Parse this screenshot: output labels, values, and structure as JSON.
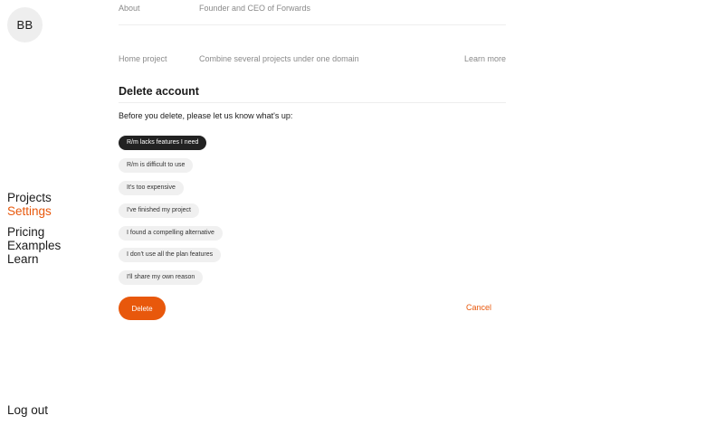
{
  "avatar": {
    "initials": "BB"
  },
  "nav": {
    "group1": [
      "Projects",
      "Settings"
    ],
    "group2": [
      "Pricing",
      "Examples",
      "Learn"
    ],
    "active": "Settings"
  },
  "logout_label": "Log out",
  "info": {
    "rows": [
      {
        "key": "About",
        "value": "Founder and CEO of Forwards",
        "link": ""
      },
      {
        "key": "Home project",
        "value": "Combine several projects under one domain",
        "link": "Learn more"
      }
    ]
  },
  "delete_section": {
    "title": "Delete account",
    "prompt": "Before you delete, please let us know what's up:",
    "reasons": [
      {
        "label": "R/m lacks features I need",
        "selected": true
      },
      {
        "label": "R/m is difficult to use",
        "selected": false
      },
      {
        "label": "It's too expensive",
        "selected": false
      },
      {
        "label": "I've finished my project",
        "selected": false
      },
      {
        "label": "I found a compelling alternative",
        "selected": false
      },
      {
        "label": "I don't use all the plan features",
        "selected": false
      },
      {
        "label": "I'll share my own reason",
        "selected": false
      }
    ],
    "delete_label": "Delete",
    "cancel_label": "Cancel"
  },
  "colors": {
    "accent": "#e8580c",
    "chip_bg": "#f0f0f0",
    "chip_selected_bg": "#222222",
    "muted_text": "#8a8a8a"
  }
}
